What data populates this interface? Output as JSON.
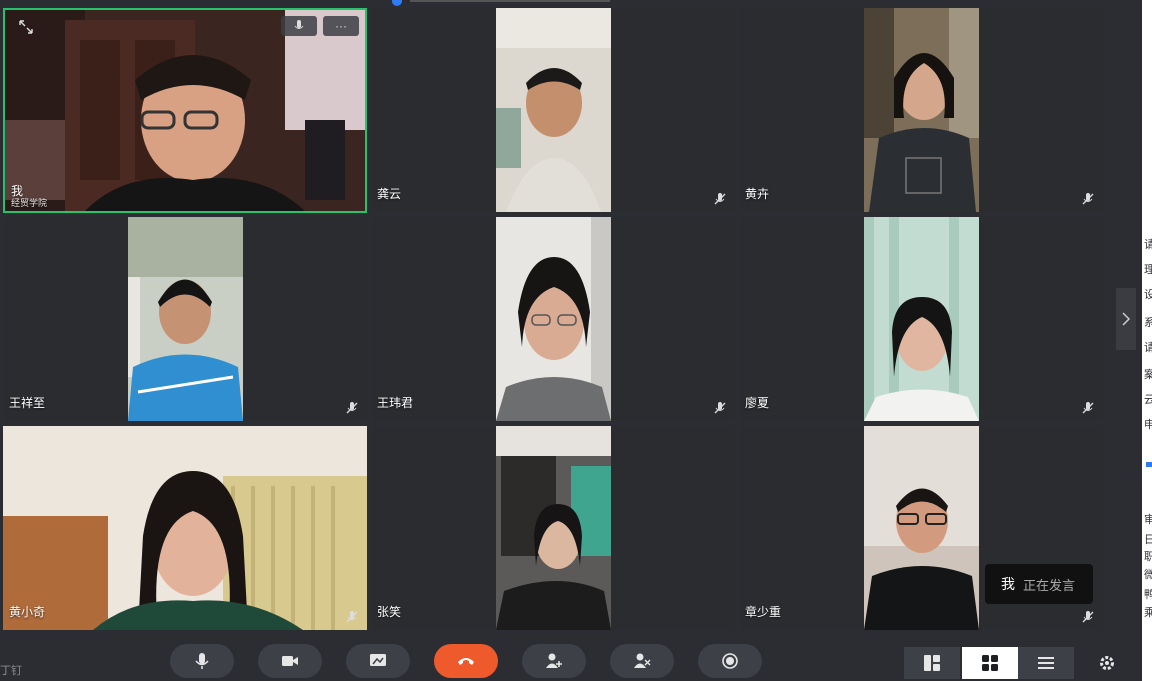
{
  "self_tile": {
    "name": "我",
    "org": "经贸学院",
    "expand_icon": "expand-icon",
    "mic_icon": "microphone-icon",
    "more_label": "···"
  },
  "participants": [
    {
      "name": "龚云"
    },
    {
      "name": "黄卉"
    },
    {
      "name": "王祥至"
    },
    {
      "name": "王玮君"
    },
    {
      "name": "廖夏"
    },
    {
      "name": "黄小奇"
    },
    {
      "name": "张笑"
    },
    {
      "name": "章少重"
    }
  ],
  "speaking": {
    "who": "我",
    "status": "正在发言"
  },
  "footer": {
    "left_text": "丁钉"
  },
  "side_panel": {
    "chars": [
      "请",
      "理",
      "设",
      "系",
      "请",
      "案",
      "云",
      "申",
      "审",
      "日",
      "职",
      "微",
      "鸭",
      "乘"
    ]
  },
  "controls": [
    {
      "icon": "microphone-icon"
    },
    {
      "icon": "video-camera-icon"
    },
    {
      "icon": "screen-share-icon"
    },
    {
      "icon": "hang-up-icon"
    },
    {
      "icon": "add-member-icon"
    },
    {
      "icon": "members-icon"
    },
    {
      "icon": "record-icon"
    }
  ],
  "layouts": [
    {
      "icon": "speaker-layout-icon",
      "active": false
    },
    {
      "icon": "grid-layout-icon",
      "active": true
    },
    {
      "icon": "list-layout-icon",
      "active": false
    }
  ],
  "colors": {
    "background": "#2b2d33",
    "tile": "#2a2c30",
    "active_border": "#27c26c",
    "hangup": "#ef5a2c",
    "accent": "#2f7cf6"
  }
}
